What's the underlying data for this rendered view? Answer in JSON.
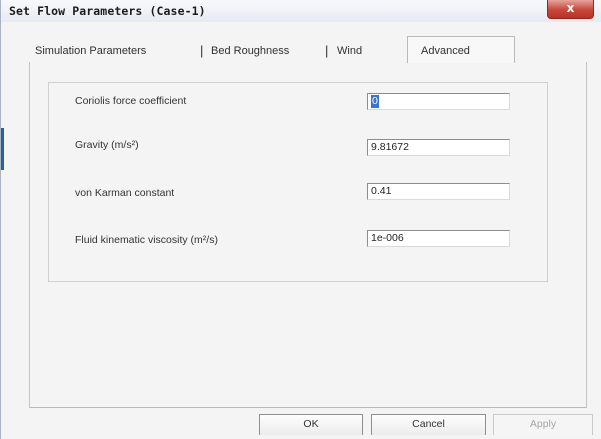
{
  "window": {
    "title": "Set Flow Parameters (Case-1)",
    "close_glyph": "x"
  },
  "tabs": [
    {
      "label": "Simulation Parameters"
    },
    {
      "label": "Bed Roughness"
    },
    {
      "label": "Wind"
    },
    {
      "label": "Advanced",
      "active": true
    }
  ],
  "advanced": {
    "fields": [
      {
        "label": "Coriolis force coefficient",
        "value": "0"
      },
      {
        "label": "Gravity (m/s²)",
        "value": "9.81672"
      },
      {
        "label": "von Karman constant",
        "value": "0.41"
      },
      {
        "label": "Fluid kinematic viscosity (m²/s)",
        "value": "1e-006"
      }
    ]
  },
  "buttons": {
    "ok": "OK",
    "cancel": "Cancel",
    "apply": "Apply"
  },
  "icons": {
    "close": "close-icon"
  },
  "colors": {
    "close_button": "#c8463a",
    "selection": "#3875d7"
  }
}
